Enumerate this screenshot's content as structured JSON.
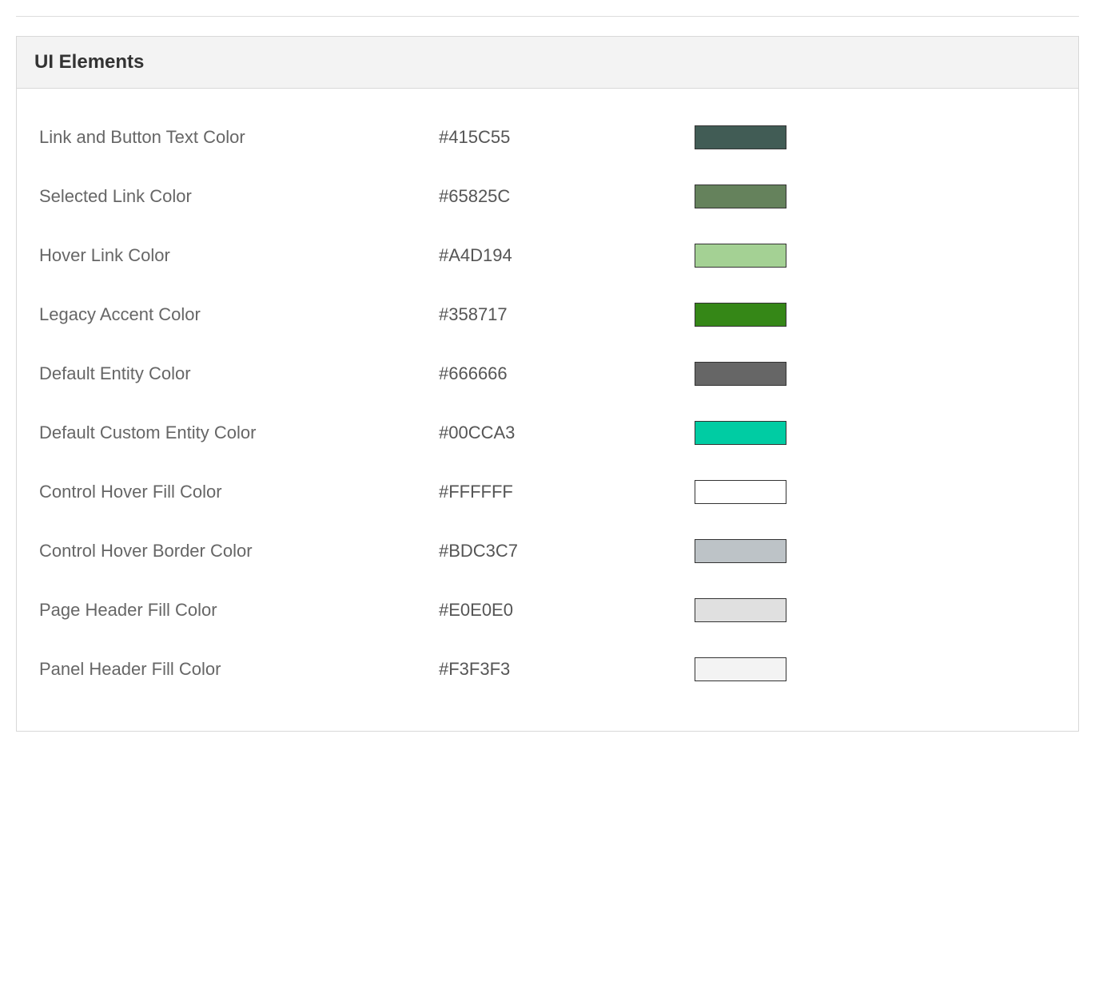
{
  "panel": {
    "title": "UI Elements",
    "rows": [
      {
        "label": "Link and Button Text Color",
        "value": "#415C55",
        "color": "#415C55"
      },
      {
        "label": "Selected Link Color",
        "value": "#65825C",
        "color": "#65825C"
      },
      {
        "label": "Hover Link Color",
        "value": "#A4D194",
        "color": "#A4D194"
      },
      {
        "label": "Legacy Accent Color",
        "value": "#358717",
        "color": "#358717"
      },
      {
        "label": "Default Entity Color",
        "value": "#666666",
        "color": "#666666"
      },
      {
        "label": "Default Custom Entity Color",
        "value": "#00CCA3",
        "color": "#00CCA3"
      },
      {
        "label": "Control Hover Fill Color",
        "value": "#FFFFFF",
        "color": "#FFFFFF"
      },
      {
        "label": "Control Hover Border Color",
        "value": "#BDC3C7",
        "color": "#BDC3C7"
      },
      {
        "label": "Page Header Fill Color",
        "value": "#E0E0E0",
        "color": "#E0E0E0"
      },
      {
        "label": "Panel Header Fill Color",
        "value": "#F3F3F3",
        "color": "#F3F3F3"
      }
    ]
  }
}
